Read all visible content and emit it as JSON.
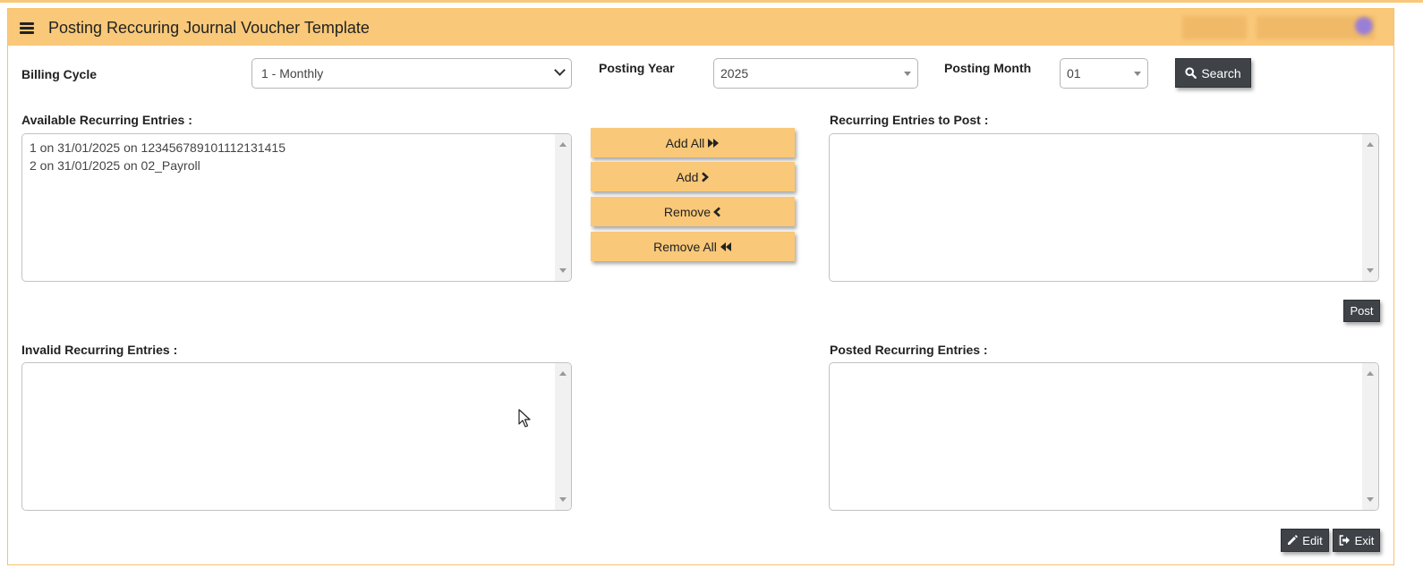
{
  "header": {
    "title": "Posting Reccuring Journal Voucher Template"
  },
  "filters": {
    "billing_cycle_label": "Billing Cycle",
    "billing_cycle_value": "1 - Monthly",
    "posting_year_label": "Posting Year",
    "posting_year_value": "2025",
    "posting_month_label": "Posting Month",
    "posting_month_value": "01",
    "search_label": "Search"
  },
  "available": {
    "label": "Available Recurring Entries :",
    "items": [
      "1 on 31/01/2025 on 123456789101112131415",
      "2 on 31/01/2025 on 02_Payroll"
    ]
  },
  "to_post": {
    "label": "Recurring Entries to Post :"
  },
  "invalid": {
    "label": "Invalid Recurring Entries :"
  },
  "posted": {
    "label": "Posted Recurring Entries :"
  },
  "actions": {
    "add_all": "Add All",
    "add": "Add",
    "remove": "Remove",
    "remove_all": "Remove All",
    "post": "Post",
    "edit": "Edit",
    "exit": "Exit"
  },
  "colors": {
    "accent": "#f9c878",
    "dark_button": "#3f4347"
  },
  "icons": [
    "hamburger-icon",
    "search-icon",
    "double-chevron-right-icon",
    "chevron-right-icon",
    "chevron-left-icon",
    "double-chevron-left-icon",
    "pencil-icon",
    "exit-icon",
    "chevron-down-icon"
  ]
}
